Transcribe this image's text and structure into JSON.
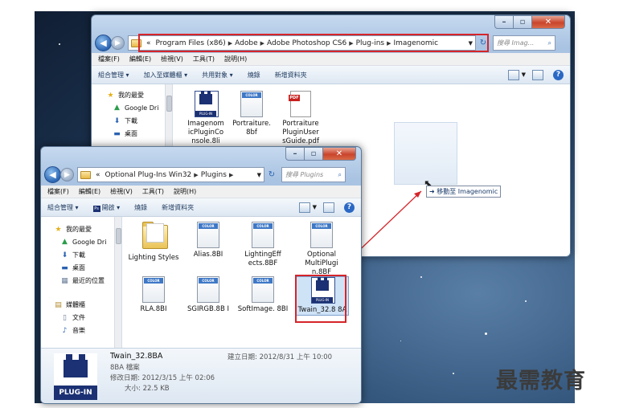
{
  "back_window": {
    "address": [
      "«",
      "Program Files (x86)",
      "Adobe",
      "Adobe Photoshop CS6",
      "Plug-ins",
      "Imagenomic"
    ],
    "search_placeholder": "搜尋 Imag...",
    "menu": [
      "檔案(F)",
      "編輯(E)",
      "檢視(V)",
      "工具(T)",
      "說明(H)"
    ],
    "toolbar": [
      "組合管理 ▾",
      "加入至媒體櫃 ▾",
      "共用對象 ▾",
      "燒錄",
      "新增資料夾"
    ],
    "nav": [
      "我的最愛",
      "Google Dri",
      "下載",
      "桌面"
    ],
    "files": [
      {
        "name": "Imagenom icPluginCo nsole.8li",
        "icon": "plugin"
      },
      {
        "name": "Portraiture. 8bf",
        "icon": "color-doc"
      },
      {
        "name": "Portraiture PluginUser sGuide.pdf",
        "icon": "pdf"
      }
    ]
  },
  "front_window": {
    "address": [
      "«",
      "Optional Plug-Ins Win32",
      "Plugins"
    ],
    "search_placeholder": "搜尋 Plugins",
    "menu": [
      "檔案(F)",
      "編輯(E)",
      "檢視(V)",
      "工具(T)",
      "說明(H)"
    ],
    "toolbar": [
      "組合管理 ▾",
      "開啟 ▾",
      "燒錄",
      "新增資料夾"
    ],
    "nav": [
      "我的最愛",
      "Google Dri",
      "下載",
      "桌面",
      "最近的位置",
      "媒體櫃",
      "文件",
      "音樂"
    ],
    "files": [
      {
        "name": "Lighting Styles",
        "icon": "folder"
      },
      {
        "name": "Alias.8BI",
        "icon": "color-doc"
      },
      {
        "name": "LightingEff ects.8BF",
        "icon": "color-doc"
      },
      {
        "name": "Optional MultiPlugi n.8BF",
        "icon": "color-doc"
      },
      {
        "name": "RLA.8BI",
        "icon": "color-doc"
      },
      {
        "name": "SGIRGB.8B I",
        "icon": "color-doc"
      },
      {
        "name": "SoftImage. 8BI",
        "icon": "color-doc"
      },
      {
        "name": "Twain_32.8 8A",
        "icon": "plugin"
      }
    ],
    "details": {
      "name": "Twain_32.8BA",
      "type": "8BA 檔案",
      "modified": "修改日期: 2012/3/15 上午 02:06",
      "size": "大小: 22.5 KB",
      "created": "建立日期: 2012/8/31 上午 10:00",
      "icon_label": "PLUG-IN"
    }
  },
  "drag_tooltip": "➜ 移動至 Imagenomic",
  "icon_labels": {
    "color": "COLOR",
    "plugin": "PLUG-IN",
    "pdf": "PDF"
  },
  "watermark": "最需教育",
  "colors": {
    "highlight_red": "#d5252a",
    "plugin_navy": "#1b3173",
    "title_blue": "#a9c3e2"
  }
}
